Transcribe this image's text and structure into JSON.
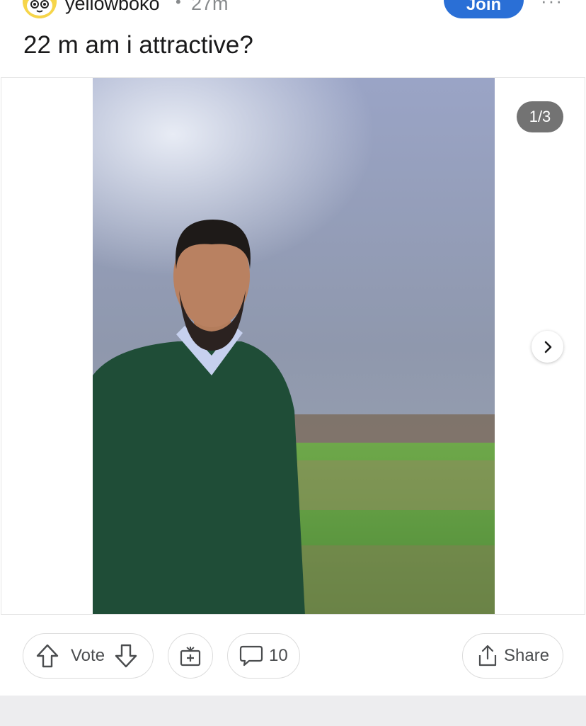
{
  "post": {
    "author": "yellowboko",
    "separator": "•",
    "age": "27m",
    "join_label": "Join",
    "more_label": "···",
    "title": "22 m am i attractive?"
  },
  "gallery": {
    "counter": "1/3"
  },
  "actions": {
    "vote_label": "Vote",
    "comment_count": "10",
    "share_label": "Share"
  },
  "colors": {
    "join_button": "#2a6fd6",
    "counter_badge": "#5a5a5a",
    "pill_border": "#dcdcdc",
    "footer_strip": "#ededef"
  },
  "icons": {
    "avatar": "snoo-avatar-icon",
    "upvote": "upvote-arrow-icon",
    "downvote": "downvote-arrow-icon",
    "award": "award-gift-icon",
    "comment": "comment-bubble-icon",
    "share": "share-upload-icon",
    "next": "chevron-right-icon"
  }
}
